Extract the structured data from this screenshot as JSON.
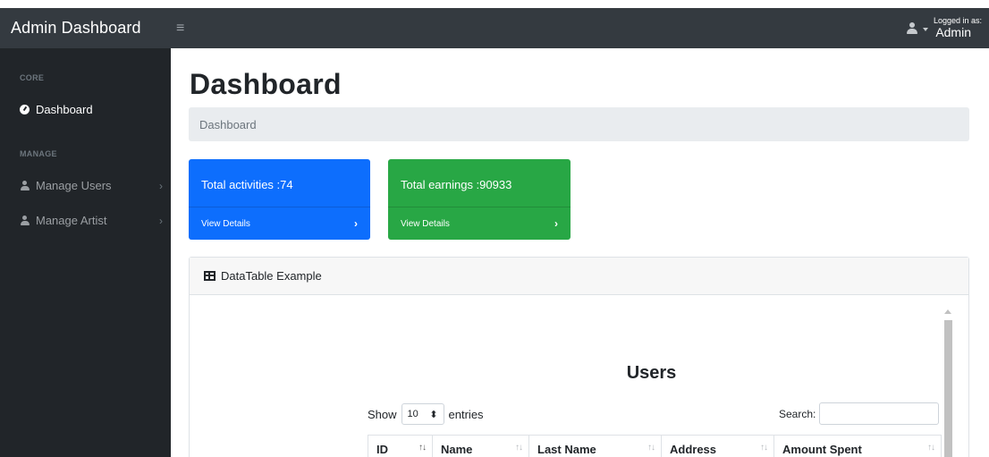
{
  "navbar": {
    "brand": "Admin Dashboard",
    "toggle_icon": "≡",
    "logged_in_label": "Logged in as:",
    "user_name": "Admin"
  },
  "sidebar": {
    "headings": [
      "CORE",
      "MANAGE"
    ],
    "items": [
      {
        "label": "Dashboard",
        "icon": "tachometer-icon"
      },
      {
        "label": "Manage Users",
        "icon": "user-icon"
      },
      {
        "label": "Manage Artist",
        "icon": "user-icon"
      }
    ]
  },
  "main": {
    "title": "Dashboard",
    "breadcrumb": "Dashboard",
    "cards": [
      {
        "title": "Total activities :74",
        "link": "View Details",
        "color": "#0d6efd"
      },
      {
        "title": "Total earnings :90933",
        "link": "View Details",
        "color": "#28a745"
      }
    ],
    "datatable": {
      "header": "DataTable Example",
      "heading": "Users",
      "show_label": "Show",
      "entries_value": "10",
      "entries_label": "entries",
      "search_label": "Search:",
      "columns": [
        "ID",
        "Name",
        "Last Name",
        "Address",
        "Amount Spent"
      ]
    }
  }
}
